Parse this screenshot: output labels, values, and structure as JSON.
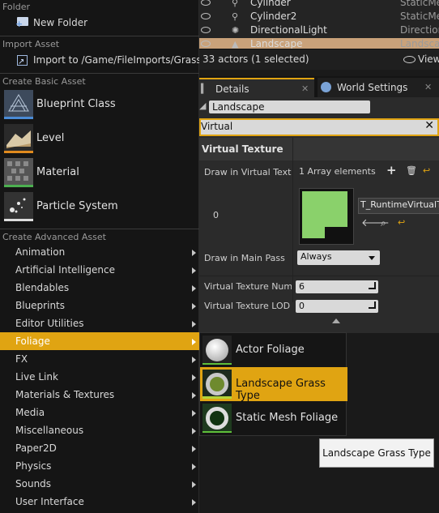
{
  "menu": {
    "folder_section": "Folder",
    "new_folder": "New Folder",
    "import_section": "Import Asset",
    "import_to": "Import to /Game/FileImports/Grass...",
    "basic_section": "Create Basic Asset",
    "basic_assets": [
      {
        "label": "Blueprint Class",
        "bar_color": "#4a8bd6"
      },
      {
        "label": "Level",
        "bar_color": "#e08a1e"
      },
      {
        "label": "Material",
        "bar_color": "#4caf50"
      },
      {
        "label": "Particle System",
        "bar_color": "#dddddd"
      }
    ],
    "advanced_section": "Create Advanced Asset",
    "categories": [
      "Animation",
      "Artificial Intelligence",
      "Blendables",
      "Blueprints",
      "Editor Utilities",
      "Foliage",
      "FX",
      "Live Link",
      "Materials & Textures",
      "Media",
      "Miscellaneous",
      "Paper2D",
      "Physics",
      "Sounds",
      "User Interface"
    ],
    "highlighted_category": "Foliage"
  },
  "outliner": {
    "rows": [
      {
        "name": "Cylinder",
        "type": "StaticMe"
      },
      {
        "name": "Cylinder2",
        "type": "StaticMe"
      },
      {
        "name": "DirectionalLight",
        "type": "Direction"
      },
      {
        "name": "Landscape",
        "type": "Landscape"
      }
    ],
    "actor_count": "33 actors (1 selected)",
    "view_options": "View"
  },
  "tabs": {
    "details": "Details",
    "world_settings": "World Settings"
  },
  "details": {
    "object_name": "Landscape",
    "search_value": "Virtual",
    "category": "Virtual Texture",
    "draw_in_vt_label": "Draw in Virtual Textur",
    "array_count": "1 Array elements",
    "index": "0",
    "texture_name": "T_RuntimeVirtualTe",
    "draw_main_pass_label": "Draw in Main Pass",
    "draw_main_pass_value": "Always",
    "num_lods_label": "Virtual Texture Num L",
    "num_lods_value": "6",
    "lod_bias_label": "Virtual Texture LOD B",
    "lod_bias_value": "0"
  },
  "submenu": {
    "items": [
      "Actor Foliage",
      "Landscape Grass Type",
      "Static Mesh Foliage"
    ],
    "highlighted": "Landscape Grass Type"
  },
  "tooltip": "Landscape Grass Type",
  "colors": {
    "accent": "#e0a412",
    "panel": "#2b2b2b",
    "menu_bg": "#151515"
  }
}
